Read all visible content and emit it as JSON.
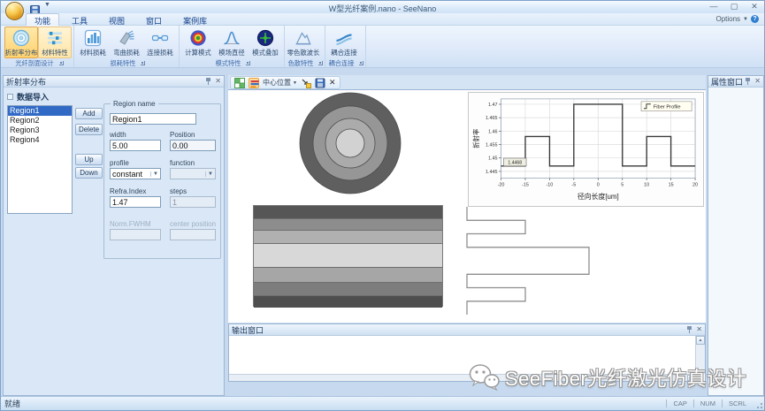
{
  "window": {
    "title": "W型光纤案例.nano - SeeNano",
    "options_label": "Options"
  },
  "ribbon_tabs": [
    {
      "label": "功能",
      "active": true
    },
    {
      "label": "工具",
      "active": false
    },
    {
      "label": "视图",
      "active": false
    },
    {
      "label": "窗口",
      "active": false
    },
    {
      "label": "案例库",
      "active": false
    }
  ],
  "ribbon": {
    "groups": [
      {
        "label": "光纤剖面设计",
        "buttons": [
          {
            "label": "折射率分布",
            "icon": "index-profile-icon",
            "state": "selected"
          },
          {
            "label": "材料特性",
            "icon": "material-property-icon",
            "state": "hl"
          }
        ]
      },
      {
        "label": "损耗特性",
        "buttons": [
          {
            "label": "材料损耗",
            "icon": "material-loss-icon",
            "state": ""
          },
          {
            "label": "弯曲损耗",
            "icon": "bend-loss-icon",
            "state": ""
          },
          {
            "label": "连接损耗",
            "icon": "splice-loss-icon",
            "state": ""
          }
        ]
      },
      {
        "label": "模式特性",
        "buttons": [
          {
            "label": "计算模式",
            "icon": "compute-modes-icon",
            "state": ""
          },
          {
            "label": "模场直径",
            "icon": "mode-field-icon",
            "state": ""
          },
          {
            "label": "模式叠加",
            "icon": "mode-overlay-icon",
            "state": ""
          }
        ]
      },
      {
        "label": "色散特性",
        "buttons": [
          {
            "label": "零色散波长",
            "icon": "zero-dispersion-icon",
            "state": ""
          }
        ]
      },
      {
        "label": "耦合连接",
        "buttons": [
          {
            "label": "耦合连接",
            "icon": "coupling-icon",
            "state": ""
          }
        ]
      }
    ]
  },
  "left_panel": {
    "title": "折射率分布",
    "data_import_label": "数据导入",
    "regions": [
      "Region1",
      "Region2",
      "Region3",
      "Region4"
    ],
    "selected_region": "Region1",
    "buttons": {
      "add": "Add",
      "delete": "Delete",
      "up": "Up",
      "down": "Down"
    },
    "form": {
      "region_name_label": "Region name",
      "region_name_value": "Region1",
      "width_label": "width",
      "width_value": "5.00",
      "position_label": "Position",
      "position_value": "0.00",
      "profile_label": "profile",
      "profile_value": "constant",
      "function_label": "function",
      "function_value": "",
      "refra_label": "Refra.Index",
      "refra_value": "1.47",
      "steps_label": "steps",
      "steps_value": "1",
      "norm_fwhm_label": "Norm.FWHM",
      "center_position_label": "center position"
    }
  },
  "doc_toolbar": {
    "center_position_label": "中心位置"
  },
  "right_panel": {
    "title": "属性窗口"
  },
  "output_panel": {
    "title": "输出窗口"
  },
  "status_bar": {
    "ready_label": "就绪",
    "indicators": [
      "CAP",
      "NUM",
      "SCRL"
    ]
  },
  "watermark": {
    "text": "SeeFiber光纤激光仿真设计"
  },
  "chart_data": {
    "type": "line",
    "title": "",
    "xlabel": "径向长度[um]",
    "ylabel": "折射率",
    "legend": [
      "Fiber Profile"
    ],
    "legend_position": "top-right",
    "grid": true,
    "xlim": [
      -20,
      20
    ],
    "ylim": [
      1.4425,
      1.472
    ],
    "xticks": [
      -20,
      -15,
      -10,
      -5,
      0,
      5,
      10,
      15,
      20
    ],
    "yticks": [
      1.445,
      1.45,
      1.455,
      1.46,
      1.465,
      1.47
    ],
    "annotation": "1.4468",
    "series": [
      {
        "name": "Fiber Profile",
        "points": [
          [
            -20,
            1.447
          ],
          [
            -15,
            1.447
          ],
          [
            -15,
            1.458
          ],
          [
            -10,
            1.458
          ],
          [
            -10,
            1.447
          ],
          [
            -5,
            1.447
          ],
          [
            -5,
            1.47
          ],
          [
            5,
            1.47
          ],
          [
            5,
            1.447
          ],
          [
            10,
            1.447
          ],
          [
            10,
            1.458
          ],
          [
            15,
            1.458
          ],
          [
            15,
            1.447
          ],
          [
            20,
            1.447
          ]
        ]
      }
    ]
  },
  "fiber_view": {
    "rings": [
      "#5f5f5f",
      "#969696",
      "#ababab",
      "#d2d2d2"
    ],
    "stripes": [
      "#565656",
      "#8d8d8d",
      "#b0b0b0",
      "#d8d8d8",
      "#a6a6a6",
      "#7d7d7d",
      "#4e4e4e"
    ],
    "stripe_heights": [
      15,
      13,
      15,
      27,
      17,
      15,
      13
    ]
  }
}
